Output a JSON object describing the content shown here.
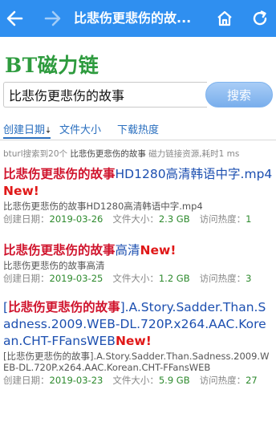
{
  "topbar": {
    "title": "比悲伤更悲伤的故..."
  },
  "logo": "BT磁力链",
  "search": {
    "value": "比悲伤更悲伤的故事",
    "button": "搜索"
  },
  "tabs": {
    "date": "创建日期",
    "size": "文件大小",
    "hot": "下载热度"
  },
  "summary": {
    "prefix": "bturl搜索到20个",
    "keyword": "比悲伤更悲伤的故事",
    "suffix": "磁力链接资源,耗时1 ms"
  },
  "labels": {
    "created": "创建日期：",
    "size": "文件大小：",
    "hot": "访问热度：",
    "new": "New!"
  },
  "results": [
    {
      "title_hl": "比悲伤更悲伤的故事",
      "title_rest": "HD1280高清韩语中字.mp4",
      "sub": "比悲伤更悲伤的故事HD1280高清韩语中字.mp4",
      "date": "2019-03-26",
      "size": "2.3 GB",
      "hot": "1"
    },
    {
      "title_hl": "比悲伤更悲伤的故事",
      "title_rest": "高清",
      "sub": "比悲伤更悲伤的故事高清",
      "date": "2019-03-25",
      "size": "1.2 GB",
      "hot": "3"
    },
    {
      "title_pre": "[",
      "title_hl": "比悲伤更悲伤的故事",
      "title_rest": "].A.Story.Sadder.Than.Sadness.2009.WEB-DL.720P.x264.AAC.Korean.CHT-FFansWEB",
      "sub": "[比悲伤更悲伤的故事].A.Story.Sadder.Than.Sadness.2009.WEB-DL.720P.x264.AAC.Korean.CHT-FFansWEB",
      "date": "2019-03-23",
      "size": "5.9 GB",
      "hot": "27"
    }
  ]
}
